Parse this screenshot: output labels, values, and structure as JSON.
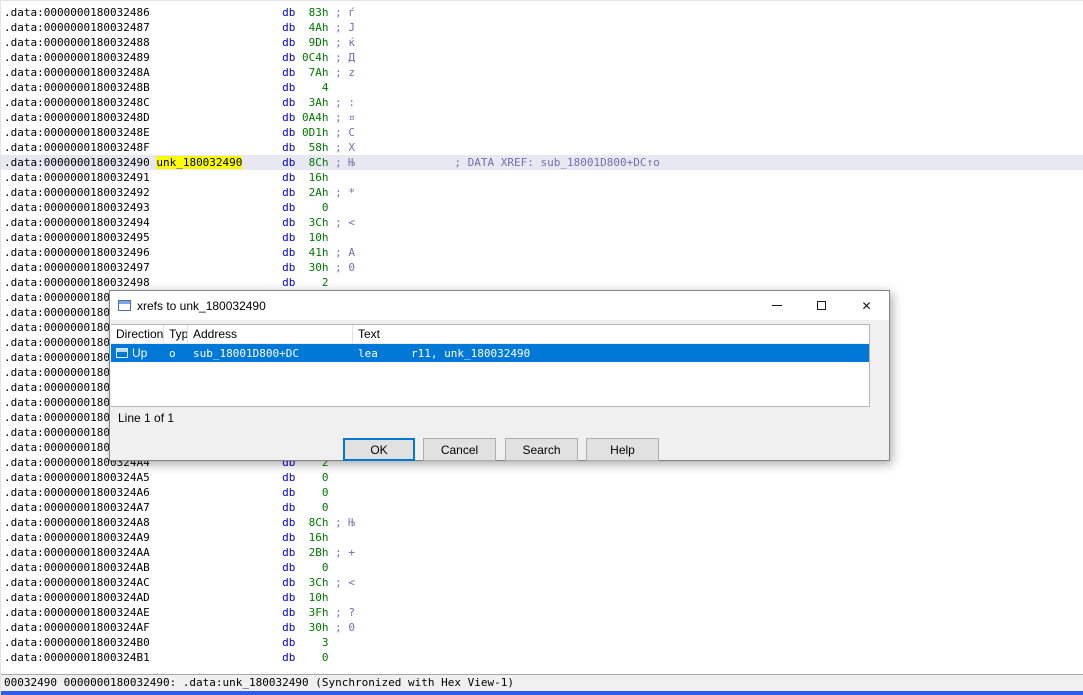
{
  "colors": {
    "selection_blue": "#0078d7",
    "name_highlight": "#fcfc00",
    "current_line": "#e8e8f2",
    "directive_blue": "#0000d0",
    "value_green": "#007800",
    "comment_blue_gray": "#7070b0",
    "bottom_strip_blue": "#2e5bf0"
  },
  "listing": {
    "directive": "db",
    "lines": [
      {
        "addr": ".data:0000000180032486",
        "value": "83h",
        "char": "ѓ"
      },
      {
        "addr": ".data:0000000180032487",
        "value": "4Ah",
        "char": "J"
      },
      {
        "addr": ".data:0000000180032488",
        "value": "9Dh",
        "char": "ќ"
      },
      {
        "addr": ".data:0000000180032489",
        "value": "0C4h",
        "char": "Д"
      },
      {
        "addr": ".data:000000018003248A",
        "value": "7Ah",
        "char": "z"
      },
      {
        "addr": ".data:000000018003248B",
        "value": "4"
      },
      {
        "addr": ".data:000000018003248C",
        "value": "3Ah",
        "char": ":"
      },
      {
        "addr": ".data:000000018003248D",
        "value": "0A4h",
        "char": "¤"
      },
      {
        "addr": ".data:000000018003248E",
        "value": "0D1h",
        "char": "С"
      },
      {
        "addr": ".data:000000018003248F",
        "value": "58h",
        "char": "X"
      },
      {
        "addr": ".data:0000000180032490",
        "name": "unk_180032490",
        "value": "8Ch",
        "char": "Њ",
        "xref": "; DATA XREF: sub_18001D800+DC↑o",
        "current": true
      },
      {
        "addr": ".data:0000000180032491",
        "value": "16h"
      },
      {
        "addr": ".data:0000000180032492",
        "value": "2Ah",
        "char": "*"
      },
      {
        "addr": ".data:0000000180032493",
        "value": "0"
      },
      {
        "addr": ".data:0000000180032494",
        "value": "3Ch",
        "char": "<"
      },
      {
        "addr": ".data:0000000180032495",
        "value": "10h"
      },
      {
        "addr": ".data:0000000180032496",
        "value": "41h",
        "char": "A"
      },
      {
        "addr": ".data:0000000180032497",
        "value": "30h",
        "char": "0"
      },
      {
        "addr": ".data:0000000180032498",
        "value": "2"
      },
      {
        "addr": ".data:0000000180032499",
        "value": ""
      },
      {
        "addr": ".data:000000018003249A",
        "value": ""
      },
      {
        "addr": ".data:000000018003249B",
        "value": ""
      },
      {
        "addr": ".data:000000018003249C",
        "value": ""
      },
      {
        "addr": ".data:000000018003249D",
        "value": ""
      },
      {
        "addr": ".data:000000018003249E",
        "value": ""
      },
      {
        "addr": ".data:000000018003249F",
        "value": ""
      },
      {
        "addr": ".data:00000001800324A0",
        "value": ""
      },
      {
        "addr": ".data:00000001800324A1",
        "value": ""
      },
      {
        "addr": ".data:00000001800324A2",
        "value": ""
      },
      {
        "addr": ".data:00000001800324A3",
        "value": ""
      },
      {
        "addr": ".data:00000001800324A4",
        "value": "2"
      },
      {
        "addr": ".data:00000001800324A5",
        "value": "0"
      },
      {
        "addr": ".data:00000001800324A6",
        "value": "0"
      },
      {
        "addr": ".data:00000001800324A7",
        "value": "0"
      },
      {
        "addr": ".data:00000001800324A8",
        "value": "8Ch",
        "char": "Њ"
      },
      {
        "addr": ".data:00000001800324A9",
        "value": "16h"
      },
      {
        "addr": ".data:00000001800324AA",
        "value": "2Bh",
        "char": "+"
      },
      {
        "addr": ".data:00000001800324AB",
        "value": "0"
      },
      {
        "addr": ".data:00000001800324AC",
        "value": "3Ch",
        "char": "<"
      },
      {
        "addr": ".data:00000001800324AD",
        "value": "10h"
      },
      {
        "addr": ".data:00000001800324AE",
        "value": "3Fh",
        "char": "?"
      },
      {
        "addr": ".data:00000001800324AF",
        "value": "30h",
        "char": "0"
      },
      {
        "addr": ".data:00000001800324B0",
        "value": "3"
      },
      {
        "addr": ".data:00000001800324B1",
        "value": "0"
      }
    ]
  },
  "dialog": {
    "title": "xrefs to unk_180032490",
    "columns": [
      "Direction",
      "Typ",
      "Address",
      "Text"
    ],
    "rows": [
      {
        "direction": "Up",
        "typ": "o",
        "address": "sub_18001D800+DC",
        "text": "lea     r11, unk_180032490",
        "selected": true
      }
    ],
    "line_status": "Line 1 of 1",
    "buttons": [
      {
        "id": "ok",
        "label": "OK",
        "default": true
      },
      {
        "id": "cancel",
        "label": "Cancel"
      },
      {
        "id": "search",
        "label": "Search"
      },
      {
        "id": "help",
        "label": "Help"
      }
    ],
    "window_controls": {
      "minimize": "minimize",
      "maximize": "maximize",
      "close": "✕"
    }
  },
  "status_bar": {
    "text": "00032490 0000000180032490: .data:unk_180032490 (Synchronized with Hex View-1)"
  }
}
